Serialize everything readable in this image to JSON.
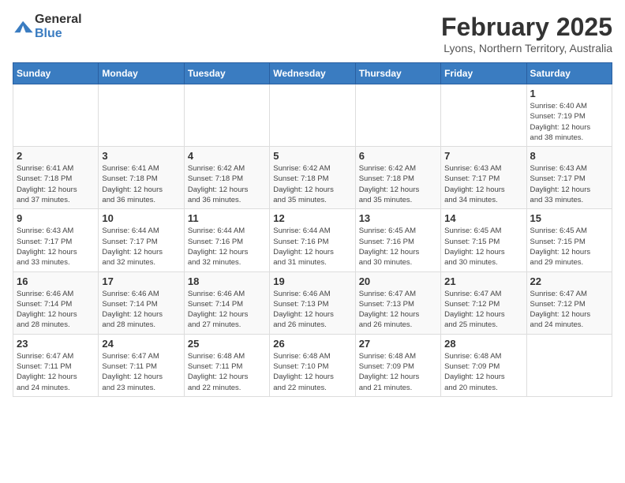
{
  "logo": {
    "general": "General",
    "blue": "Blue"
  },
  "title": "February 2025",
  "subtitle": "Lyons, Northern Territory, Australia",
  "days_of_week": [
    "Sunday",
    "Monday",
    "Tuesday",
    "Wednesday",
    "Thursday",
    "Friday",
    "Saturday"
  ],
  "weeks": [
    [
      {
        "day": "",
        "info": ""
      },
      {
        "day": "",
        "info": ""
      },
      {
        "day": "",
        "info": ""
      },
      {
        "day": "",
        "info": ""
      },
      {
        "day": "",
        "info": ""
      },
      {
        "day": "",
        "info": ""
      },
      {
        "day": "1",
        "info": "Sunrise: 6:40 AM\nSunset: 7:19 PM\nDaylight: 12 hours\nand 38 minutes."
      }
    ],
    [
      {
        "day": "2",
        "info": "Sunrise: 6:41 AM\nSunset: 7:18 PM\nDaylight: 12 hours\nand 37 minutes."
      },
      {
        "day": "3",
        "info": "Sunrise: 6:41 AM\nSunset: 7:18 PM\nDaylight: 12 hours\nand 36 minutes."
      },
      {
        "day": "4",
        "info": "Sunrise: 6:42 AM\nSunset: 7:18 PM\nDaylight: 12 hours\nand 36 minutes."
      },
      {
        "day": "5",
        "info": "Sunrise: 6:42 AM\nSunset: 7:18 PM\nDaylight: 12 hours\nand 35 minutes."
      },
      {
        "day": "6",
        "info": "Sunrise: 6:42 AM\nSunset: 7:18 PM\nDaylight: 12 hours\nand 35 minutes."
      },
      {
        "day": "7",
        "info": "Sunrise: 6:43 AM\nSunset: 7:17 PM\nDaylight: 12 hours\nand 34 minutes."
      },
      {
        "day": "8",
        "info": "Sunrise: 6:43 AM\nSunset: 7:17 PM\nDaylight: 12 hours\nand 33 minutes."
      }
    ],
    [
      {
        "day": "9",
        "info": "Sunrise: 6:43 AM\nSunset: 7:17 PM\nDaylight: 12 hours\nand 33 minutes."
      },
      {
        "day": "10",
        "info": "Sunrise: 6:44 AM\nSunset: 7:17 PM\nDaylight: 12 hours\nand 32 minutes."
      },
      {
        "day": "11",
        "info": "Sunrise: 6:44 AM\nSunset: 7:16 PM\nDaylight: 12 hours\nand 32 minutes."
      },
      {
        "day": "12",
        "info": "Sunrise: 6:44 AM\nSunset: 7:16 PM\nDaylight: 12 hours\nand 31 minutes."
      },
      {
        "day": "13",
        "info": "Sunrise: 6:45 AM\nSunset: 7:16 PM\nDaylight: 12 hours\nand 30 minutes."
      },
      {
        "day": "14",
        "info": "Sunrise: 6:45 AM\nSunset: 7:15 PM\nDaylight: 12 hours\nand 30 minutes."
      },
      {
        "day": "15",
        "info": "Sunrise: 6:45 AM\nSunset: 7:15 PM\nDaylight: 12 hours\nand 29 minutes."
      }
    ],
    [
      {
        "day": "16",
        "info": "Sunrise: 6:46 AM\nSunset: 7:14 PM\nDaylight: 12 hours\nand 28 minutes."
      },
      {
        "day": "17",
        "info": "Sunrise: 6:46 AM\nSunset: 7:14 PM\nDaylight: 12 hours\nand 28 minutes."
      },
      {
        "day": "18",
        "info": "Sunrise: 6:46 AM\nSunset: 7:14 PM\nDaylight: 12 hours\nand 27 minutes."
      },
      {
        "day": "19",
        "info": "Sunrise: 6:46 AM\nSunset: 7:13 PM\nDaylight: 12 hours\nand 26 minutes."
      },
      {
        "day": "20",
        "info": "Sunrise: 6:47 AM\nSunset: 7:13 PM\nDaylight: 12 hours\nand 26 minutes."
      },
      {
        "day": "21",
        "info": "Sunrise: 6:47 AM\nSunset: 7:12 PM\nDaylight: 12 hours\nand 25 minutes."
      },
      {
        "day": "22",
        "info": "Sunrise: 6:47 AM\nSunset: 7:12 PM\nDaylight: 12 hours\nand 24 minutes."
      }
    ],
    [
      {
        "day": "23",
        "info": "Sunrise: 6:47 AM\nSunset: 7:11 PM\nDaylight: 12 hours\nand 24 minutes."
      },
      {
        "day": "24",
        "info": "Sunrise: 6:47 AM\nSunset: 7:11 PM\nDaylight: 12 hours\nand 23 minutes."
      },
      {
        "day": "25",
        "info": "Sunrise: 6:48 AM\nSunset: 7:11 PM\nDaylight: 12 hours\nand 22 minutes."
      },
      {
        "day": "26",
        "info": "Sunrise: 6:48 AM\nSunset: 7:10 PM\nDaylight: 12 hours\nand 22 minutes."
      },
      {
        "day": "27",
        "info": "Sunrise: 6:48 AM\nSunset: 7:09 PM\nDaylight: 12 hours\nand 21 minutes."
      },
      {
        "day": "28",
        "info": "Sunrise: 6:48 AM\nSunset: 7:09 PM\nDaylight: 12 hours\nand 20 minutes."
      },
      {
        "day": "",
        "info": ""
      }
    ]
  ]
}
